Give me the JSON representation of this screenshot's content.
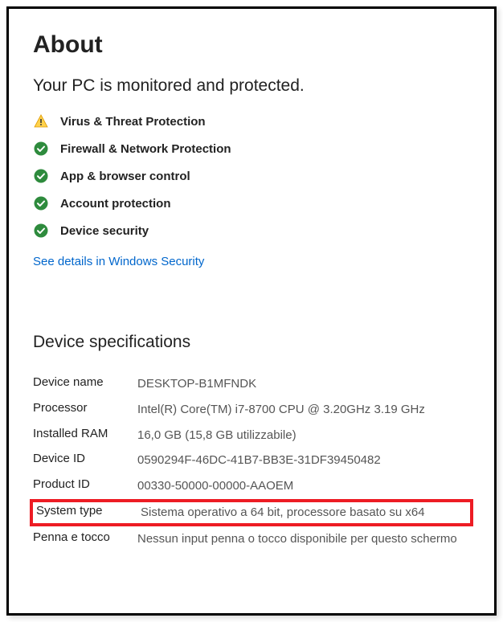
{
  "header": {
    "title": "About",
    "subtitle": "Your PC is monitored and protected."
  },
  "protection": {
    "items": [
      {
        "icon": "warning",
        "label": "Virus & Threat Protection"
      },
      {
        "icon": "check",
        "label": "Firewall & Network Protection"
      },
      {
        "icon": "check",
        "label": "App & browser control"
      },
      {
        "icon": "check",
        "label": "Account protection"
      },
      {
        "icon": "check",
        "label": "Device security"
      }
    ]
  },
  "securityLink": "See details in Windows Security",
  "specs": {
    "heading": "Device specifications",
    "rows": {
      "deviceName": {
        "label": "Device name",
        "value": "DESKTOP-B1MFNDK"
      },
      "processor": {
        "label": "Processor",
        "value": "Intel(R) Core(TM) i7-8700 CPU @ 3.20GHz   3.19 GHz"
      },
      "installedRam": {
        "label": "Installed RAM",
        "value": "16,0 GB (15,8 GB utilizzabile)"
      },
      "deviceId": {
        "label": "Device ID",
        "value": "0590294F-46DC-41B7-BB3E-31DF39450482"
      },
      "productId": {
        "label": "Product ID",
        "value": "00330-50000-00000-AAOEM"
      },
      "systemType": {
        "label": "System type",
        "value": "Sistema operativo a 64 bit, processore basato su x64"
      },
      "penTouch": {
        "label": "Penna e tocco",
        "value": "Nessun input penna o tocco disponibile per questo schermo"
      }
    }
  }
}
